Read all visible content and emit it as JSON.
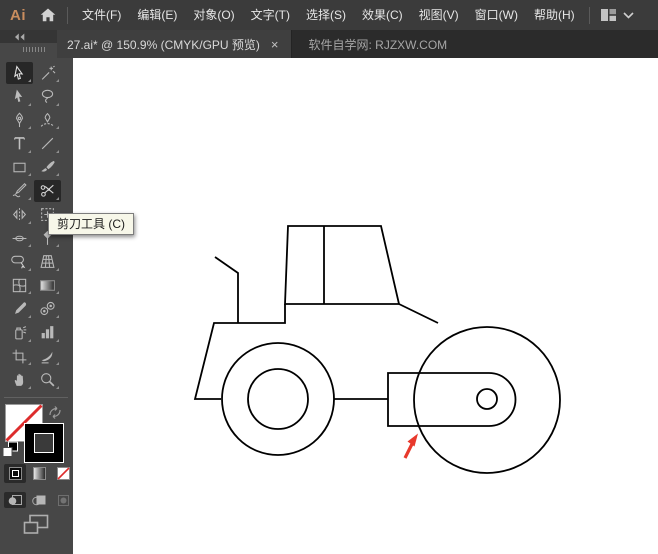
{
  "menubar": {
    "logo": "Ai",
    "menus": [
      "文件(F)",
      "编辑(E)",
      "对象(O)",
      "文字(T)",
      "选择(S)",
      "效果(C)",
      "视图(V)",
      "窗口(W)",
      "帮助(H)"
    ]
  },
  "tabbar": {
    "document_tab": "27.ai* @ 150.9% (CMYK/GPU 预览)",
    "close_glyph": "×",
    "promo_text": "软件自学网: RJZXW.COM"
  },
  "tooltip": {
    "text": "剪刀工具 (C)"
  },
  "tools_panel": {
    "active_tool": "scissors-tool",
    "selected_arrow_tool": "selection-tool",
    "tools": [
      "selection",
      "magic-wand",
      "direct-selection",
      "lasso",
      "pen",
      "curvature",
      "type",
      "line-segment",
      "rectangle",
      "paintbrush",
      "shaper",
      "scissors",
      "reflect",
      "free-transform",
      "width",
      "puppet-warp",
      "shape-builder",
      "perspective-grid",
      "mesh",
      "gradient",
      "eyedropper",
      "blend",
      "symbol-sprayer",
      "column-graph",
      "artboard",
      "slice",
      "hand",
      "zoom"
    ],
    "fill_color": "none",
    "stroke_color": "#000000"
  },
  "canvas": {
    "zoom_level": "150.9%",
    "artwork": "road roller line drawing",
    "annotation_arrow_color": "#e8392c"
  },
  "colors": {
    "menubar_bg": "#3b3b3b",
    "panel_bg": "#474747",
    "canvas_bg": "#ffffff",
    "logo_orange": "#c98d5e",
    "arrow_red": "#e8392c",
    "tooltip_bg": "#f7f7e9"
  }
}
